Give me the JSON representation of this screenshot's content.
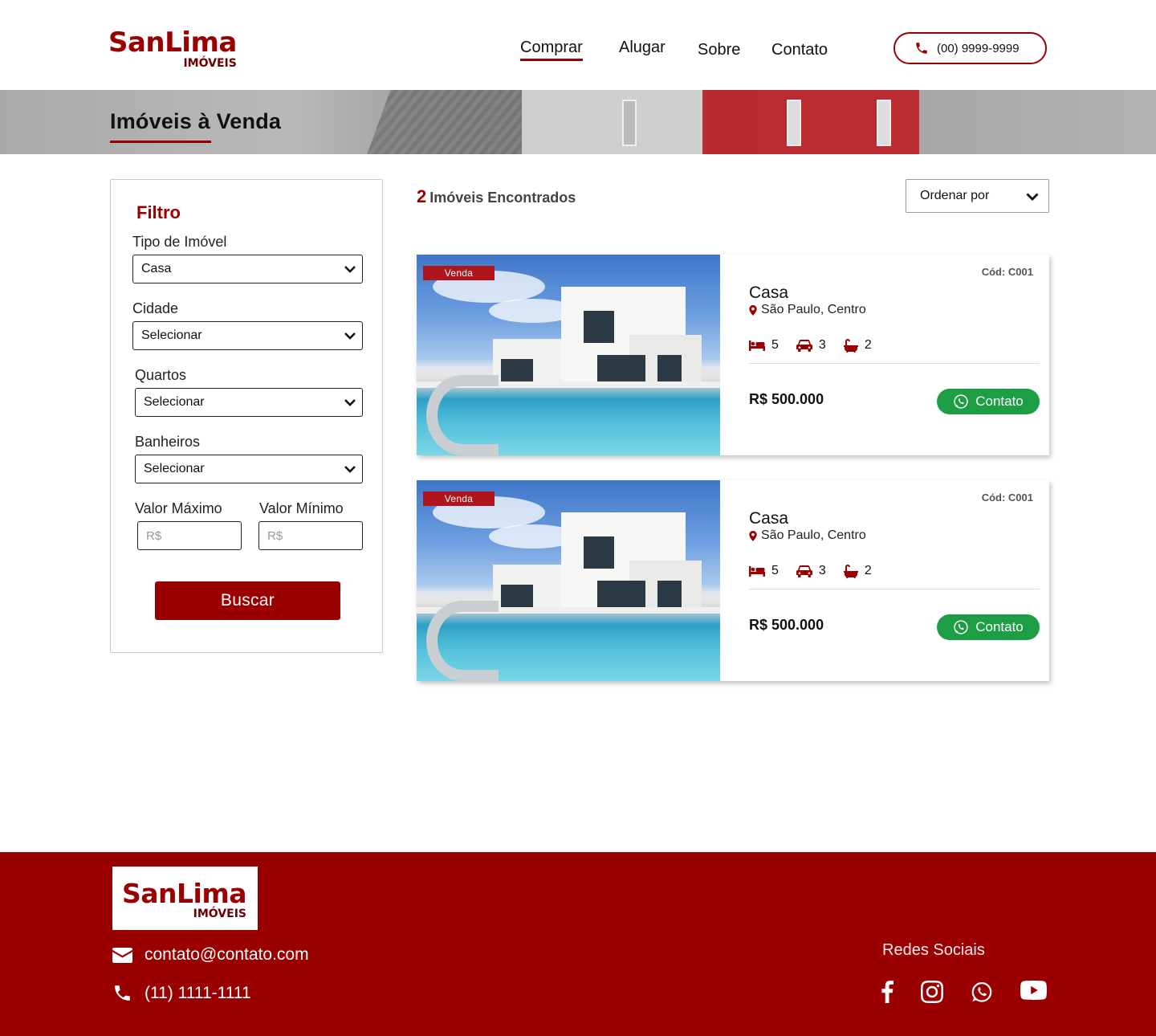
{
  "brand": {
    "name": "SanLima",
    "sub": "IMÓVEIS"
  },
  "nav": {
    "items": [
      "Comprar",
      "Alugar",
      "Sobre",
      "Contato"
    ],
    "active": "Comprar"
  },
  "header": {
    "phone": "(00) 9999-9999"
  },
  "banner": {
    "title": "Imóveis à Venda"
  },
  "filter": {
    "title": "Filtro",
    "tipo_label": "Tipo de Imóvel",
    "tipo_value": "Casa",
    "cidade_label": "Cidade",
    "cidade_value": "Selecionar",
    "quartos_label": "Quartos",
    "quartos_value": "Selecionar",
    "banheiros_label": "Banheiros",
    "banheiros_value": "Selecionar",
    "valor_max_label": "Valor Máximo",
    "valor_min_label": "Valor Mínimo",
    "valor_max_placeholder": "R$",
    "valor_min_placeholder": "R$",
    "button": "Buscar"
  },
  "results": {
    "count": "2",
    "label": "Imóveis Encontrados",
    "order_label": "Ordenar por"
  },
  "listings": [
    {
      "badge": "Venda",
      "code": "Cód: C001",
      "type": "Casa",
      "location": "São Paulo, Centro",
      "beds": "5",
      "cars": "3",
      "baths": "2",
      "price": "R$ 500.000",
      "contact": "Contato"
    },
    {
      "badge": "Venda",
      "code": "Cód: C001",
      "type": "Casa",
      "location": "São Paulo, Centro",
      "beds": "5",
      "cars": "3",
      "baths": "2",
      "price": "R$ 500.000",
      "contact": "Contato"
    }
  ],
  "footer": {
    "email": "contato@contato.com",
    "phone": "(11) 1111-1111",
    "social_title": "Redes Sociais",
    "social_icons": [
      "facebook-icon",
      "instagram-icon",
      "whatsapp-icon",
      "youtube-icon"
    ]
  },
  "colors": {
    "brand_red": "#9b0000",
    "whatsapp_green": "#1e9e44",
    "badge_red": "#b0141c"
  }
}
